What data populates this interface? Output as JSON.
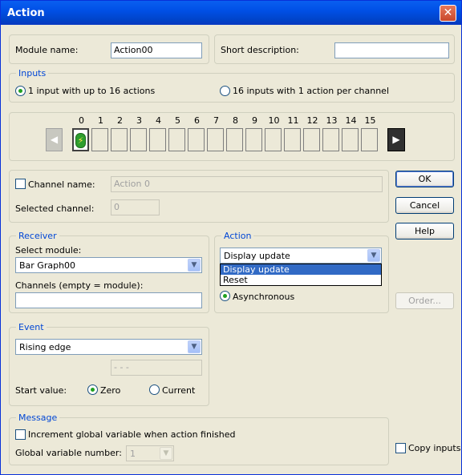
{
  "window": {
    "title": "Action",
    "close_glyph": "✕"
  },
  "module": {
    "name_label": "Module name:",
    "name_value": "Action00",
    "short_desc_label": "Short description:",
    "short_desc_value": ""
  },
  "inputs": {
    "legend": "Inputs",
    "option1": "1 input with up to 16 actions",
    "option2": "16 inputs with 1 action per channel",
    "selected": 1
  },
  "channels": {
    "numbers": [
      "0",
      "1",
      "2",
      "3",
      "4",
      "5",
      "6",
      "7",
      "8",
      "9",
      "10",
      "11",
      "12",
      "13",
      "14",
      "15"
    ],
    "current": 0
  },
  "channel": {
    "name_label": "Channel name:",
    "name_value": "Action 0",
    "selected_label": "Selected channel:",
    "selected_value": "0"
  },
  "buttons": {
    "ok": "OK",
    "cancel": "Cancel",
    "help": "Help",
    "order": "Order..."
  },
  "receiver": {
    "legend": "Receiver",
    "select_label": "Select module:",
    "select_value": "Bar Graph00",
    "channels_label": "Channels (empty = module):",
    "channels_value": ""
  },
  "action": {
    "legend": "Action",
    "value": "Display update",
    "options": [
      "Display update",
      "Reset"
    ],
    "async_label": "Asynchronous"
  },
  "event": {
    "legend": "Event",
    "value": "Rising edge",
    "param_value": "- - -",
    "start_label": "Start value:",
    "zero_label": "Zero",
    "current_label": "Current"
  },
  "message": {
    "legend": "Message",
    "increment_label": "Increment global variable when action finished",
    "global_label": "Global variable number:",
    "global_value": "1"
  },
  "copy_inputs": "Copy inputs",
  "colors": {
    "title_bar": "#0a5ff0",
    "dialog_bg": "#ece9d8",
    "legend": "#0046d5",
    "selection": "#316ac5"
  }
}
